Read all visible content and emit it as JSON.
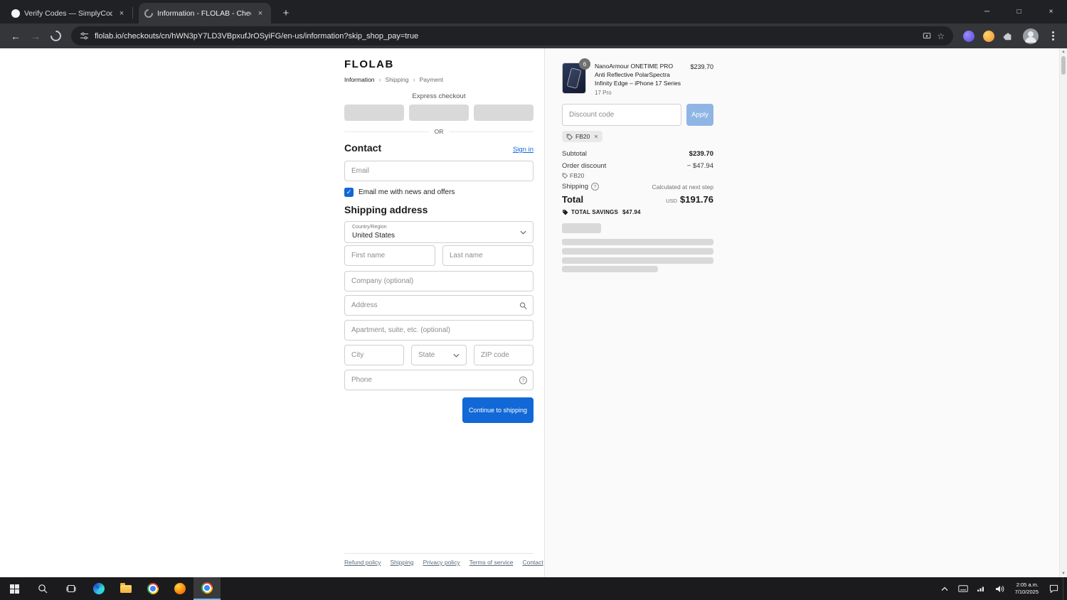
{
  "colors": {
    "accent": "#1168d6",
    "apply_button": "#8fb5e5",
    "skeleton": "#d9d9d9",
    "summary_bg": "#fafafa",
    "browser_dark": "#202124",
    "toolbar_dark": "#35363a",
    "taskbar_dark": "#1b1b1d"
  },
  "icons": {
    "back": "←",
    "forward": "→",
    "close": "×",
    "plus": "+",
    "minimize": "─",
    "maximize": "□",
    "star": "☆",
    "check": "✓",
    "question": "?",
    "scroll_up": "▲",
    "scroll_down": "▼",
    "breadcrumb_chevron": "›"
  },
  "browser": {
    "tabs": [
      {
        "title": "Verify Codes — SimplyCodes"
      },
      {
        "title": "Information - FLOLAB - Checko"
      }
    ],
    "url": "flolab.io/checkouts/cn/hWN3pY7LD3VBpxufJrOSyiFG/en-us/information?skip_shop_pay=true"
  },
  "checkout": {
    "logo": "FLOLAB",
    "breadcrumb": [
      "Information",
      "Shipping",
      "Payment"
    ],
    "express_label": "Express checkout",
    "or_label": "OR",
    "contact": {
      "heading": "Contact",
      "sign_in": "Sign in",
      "email_placeholder": "Email",
      "news_label": "Email me with news and offers"
    },
    "shipping": {
      "heading": "Shipping address",
      "country_label": "Country/Region",
      "country_value": "United States",
      "first_name": "First name",
      "last_name": "Last name",
      "company": "Company (optional)",
      "address": "Address",
      "apartment": "Apartment, suite, etc. (optional)",
      "city": "City",
      "state": "State",
      "zip": "ZIP code",
      "phone": "Phone"
    },
    "continue_button": "Continue to shipping",
    "footer_links": [
      "Refund policy",
      "Shipping",
      "Privacy policy",
      "Terms of service",
      "Contact"
    ]
  },
  "summary": {
    "item": {
      "qty": "6",
      "title": "NanoArmour ONETIME PRO Anti Reflective PolarSpectra Infinity Edge – iPhone 17 Series",
      "variant": "17 Pro",
      "price": "$239.70"
    },
    "discount_placeholder": "Discount code",
    "apply_label": "Apply",
    "applied_code": "FB20",
    "rows": {
      "subtotal_label": "Subtotal",
      "subtotal_value": "$239.70",
      "discount_label": "Order discount",
      "discount_code": "FB20",
      "discount_value": "− $47.94",
      "shipping_label": "Shipping",
      "shipping_value": "Calculated at next step",
      "total_label": "Total",
      "currency": "USD",
      "total_value": "$191.76",
      "savings_label": "TOTAL SAVINGS",
      "savings_value": "$47.94"
    }
  },
  "taskbar": {
    "time": "2:05 a.m.",
    "date": "7/10/2025"
  }
}
